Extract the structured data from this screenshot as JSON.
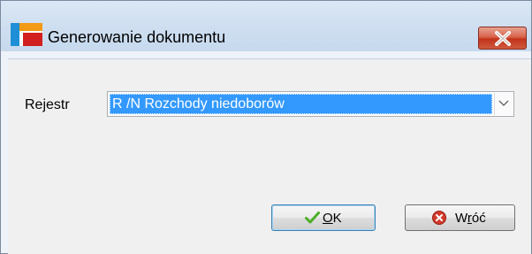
{
  "window": {
    "title": "Generowanie dokumentu",
    "icon": "app-icon"
  },
  "form": {
    "rejestr_label": "Rejestr",
    "rejestr_value": "R /N Rozchody niedoborów"
  },
  "buttons": {
    "ok": {
      "mnemonic": "O",
      "rest": "K",
      "icon": "checkmark-icon"
    },
    "back": {
      "prefix": "W",
      "mnemonic": "r",
      "rest": "óć",
      "icon": "cancel-icon"
    }
  },
  "colors": {
    "selection": "#3399ff",
    "close_button": "#c9462c",
    "ok_icon": "#4caf28",
    "cancel_icon": "#d23b2b"
  }
}
